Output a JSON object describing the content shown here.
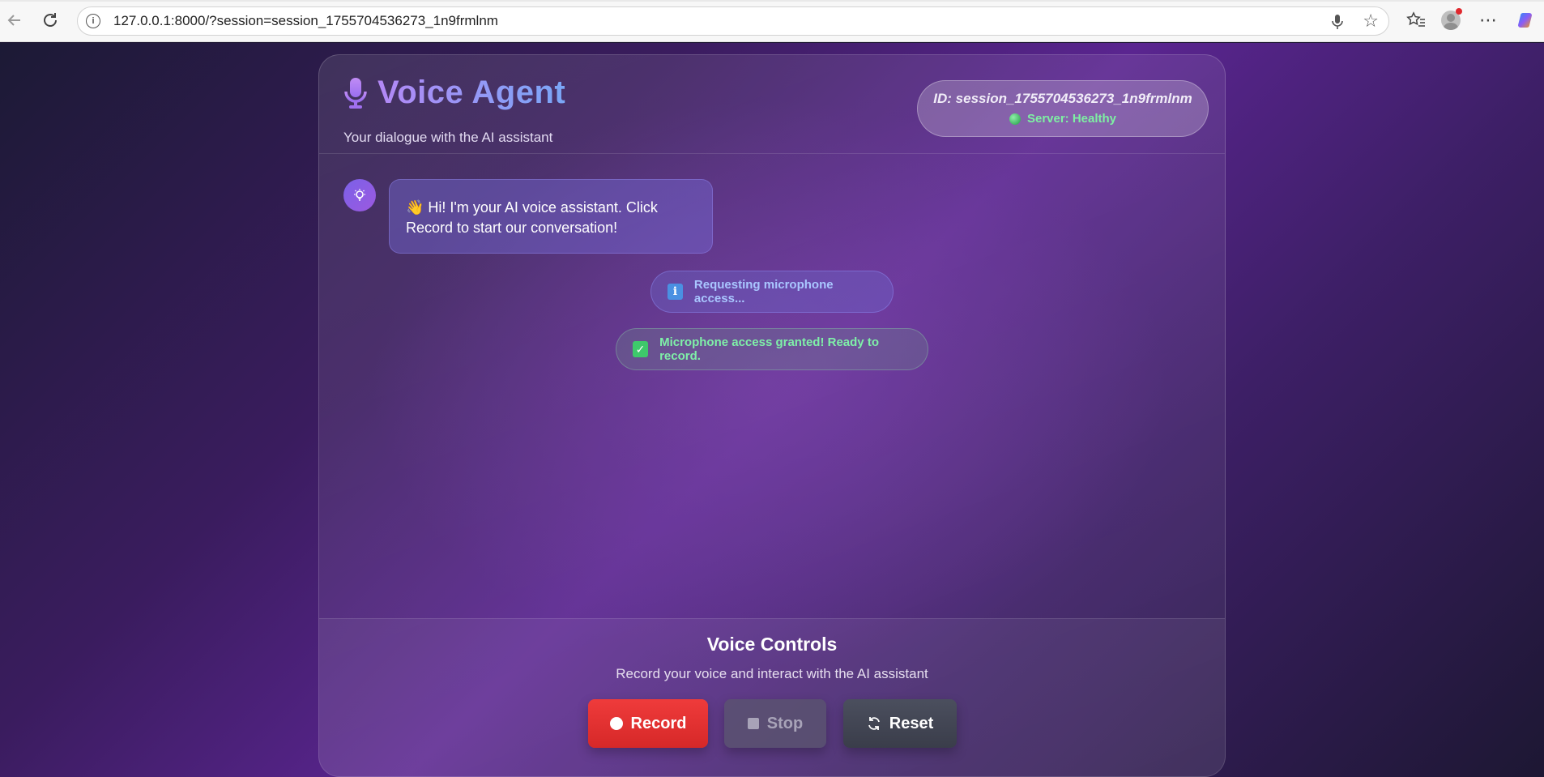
{
  "browser": {
    "url": "127.0.0.1:8000/?session=session_1755704536273_1n9frmlnm"
  },
  "header": {
    "title": "Voice Agent",
    "subtitle": "Your dialogue with the AI assistant",
    "session_id": "ID: session_1755704536273_1n9frmlnm",
    "server_status": "Server: Healthy"
  },
  "chat": {
    "assistant_message": "👋 Hi! I'm your AI voice assistant. Click Record to start our conversation!"
  },
  "status_messages": [
    {
      "icon": "info-icon",
      "text": "Requesting microphone access..."
    },
    {
      "icon": "check-icon",
      "text": "Microphone access granted! Ready to record."
    }
  ],
  "controls": {
    "title": "Voice Controls",
    "subtitle": "Record your voice and interact with the AI assistant",
    "record_label": "Record",
    "stop_label": "Stop",
    "reset_label": "Reset"
  },
  "colors": {
    "record": "#e53030",
    "status_ok": "#7ff0a8",
    "status_info": "#a9c6ff",
    "accent": "#9a86f0"
  }
}
